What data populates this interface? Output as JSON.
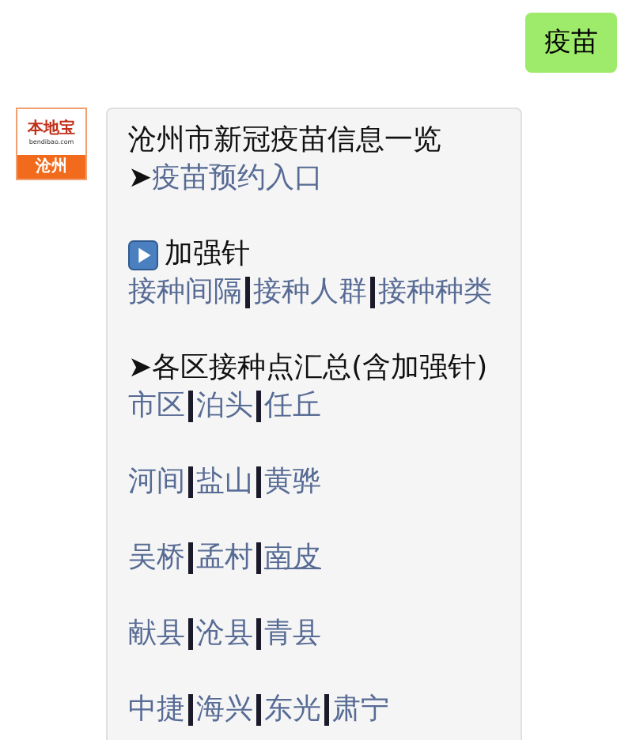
{
  "sent_message": {
    "text": "疫苗"
  },
  "received_message": {
    "avatar": {
      "logo": "本地宝",
      "site": "bendibao.com",
      "city": "沧州"
    },
    "paragraphs": [
      [
        {
          "kind": "text",
          "text": "沧州市新冠疫苗信息一览"
        },
        {
          "kind": "bullet",
          "bullet": "➤",
          "text": "疫苗预约入口",
          "link": true
        }
      ],
      [
        {
          "kind": "play_heading",
          "text": "加强针"
        },
        {
          "kind": "links",
          "links": [
            {
              "text": "接种间隔",
              "underlined": false
            },
            {
              "text": "接种人群",
              "underlined": false
            },
            {
              "text": "接种种类",
              "underlined": false
            }
          ]
        }
      ],
      [
        {
          "kind": "bullet",
          "bullet": "➤",
          "text": "各区接种点汇总(含加强针)",
          "link": false
        },
        {
          "kind": "links",
          "links": [
            {
              "text": "市区",
              "underlined": false
            },
            {
              "text": "泊头",
              "underlined": false
            },
            {
              "text": "任丘",
              "underlined": false
            }
          ]
        }
      ],
      [
        {
          "kind": "links",
          "links": [
            {
              "text": "河间",
              "underlined": false
            },
            {
              "text": "盐山",
              "underlined": false
            },
            {
              "text": "黄骅",
              "underlined": false
            }
          ]
        }
      ],
      [
        {
          "kind": "links",
          "links": [
            {
              "text": "吴桥",
              "underlined": false
            },
            {
              "text": "孟村",
              "underlined": false
            },
            {
              "text": "南皮",
              "underlined": true
            }
          ]
        }
      ],
      [
        {
          "kind": "links",
          "links": [
            {
              "text": "献县",
              "underlined": false
            },
            {
              "text": "沧县",
              "underlined": false
            },
            {
              "text": "青县",
              "underlined": false
            }
          ]
        }
      ],
      [
        {
          "kind": "links",
          "links": [
            {
              "text": "中捷",
              "underlined": false
            },
            {
              "text": "海兴",
              "underlined": false
            },
            {
              "text": "东光",
              "underlined": false
            },
            {
              "text": "肃宁",
              "underlined": false
            }
          ]
        }
      ]
    ]
  }
}
